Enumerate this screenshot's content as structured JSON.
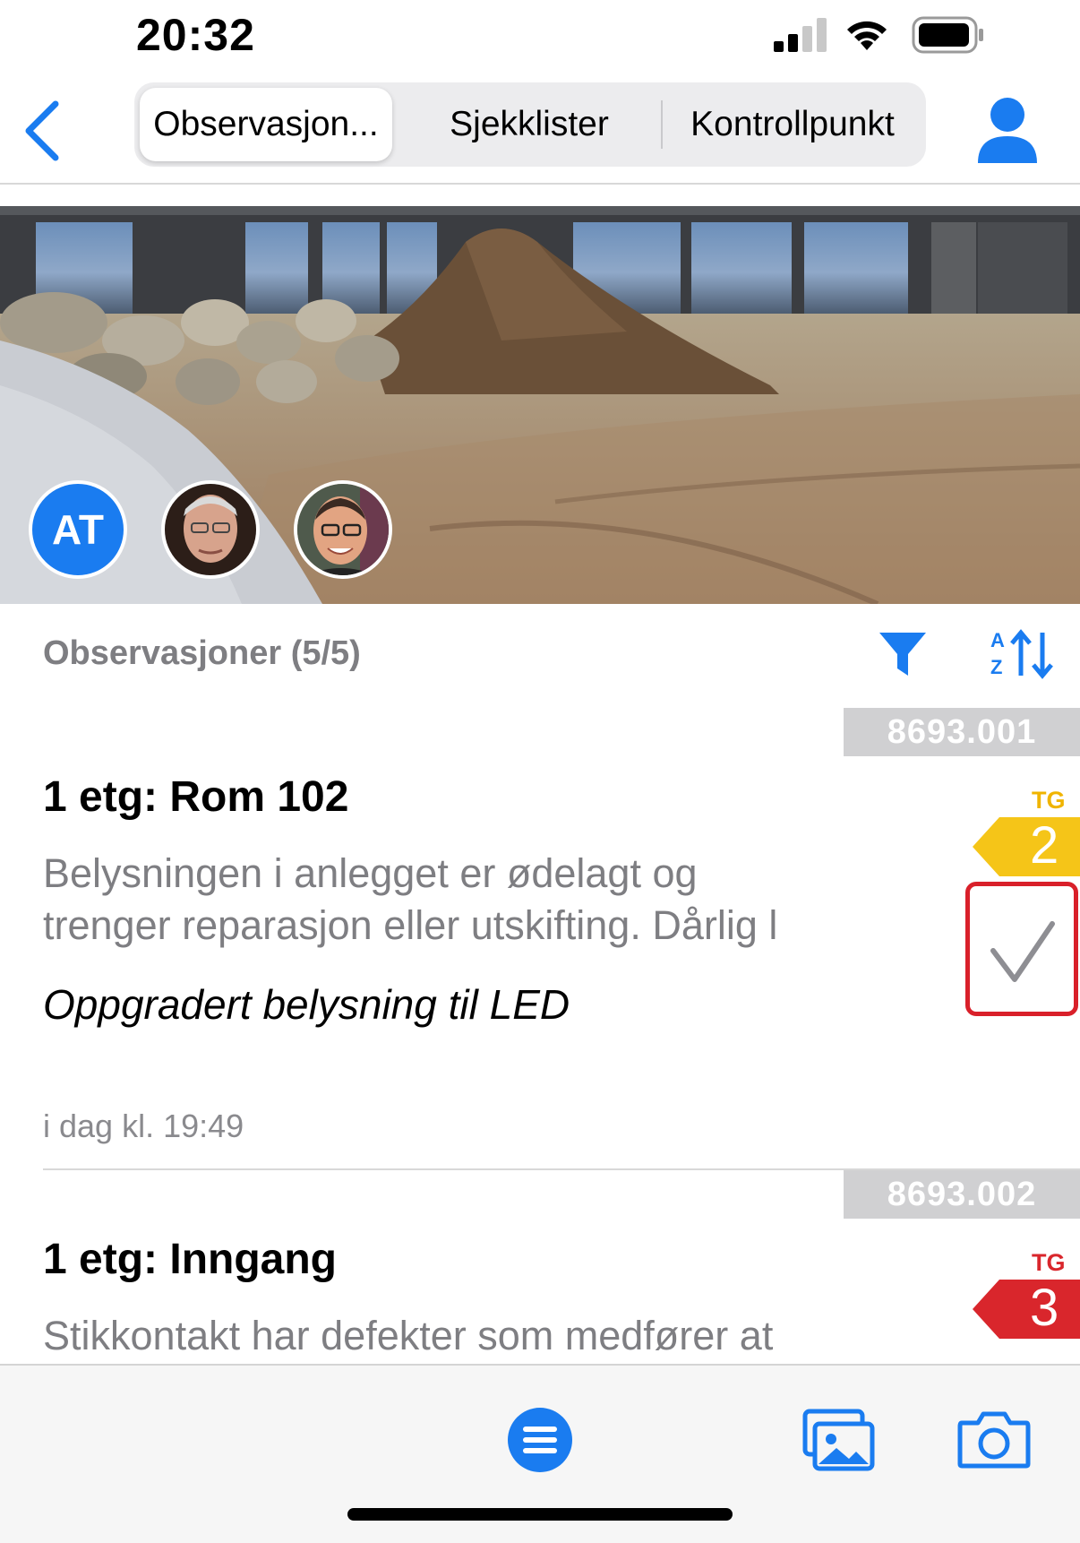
{
  "status_bar": {
    "time": "20:32"
  },
  "nav": {
    "tabs": [
      {
        "label": "Observasjon...",
        "active": true
      },
      {
        "label": "Sjekklister",
        "active": false
      },
      {
        "label": "Kontrollpunkt",
        "active": false
      }
    ]
  },
  "hero": {
    "avatars": [
      {
        "initials": "AT",
        "color": "#1a7cf0"
      },
      {
        "kind": "photo"
      },
      {
        "kind": "photo"
      }
    ]
  },
  "list": {
    "header": "Observasjoner (5/5)",
    "icons": {
      "filter": "filter-icon",
      "sort": "sort-az-icon"
    }
  },
  "observations": [
    {
      "id": "8693.001",
      "title": "1 etg: Rom 102",
      "desc_line1": "Belysningen i anlegget er ødelagt og",
      "desc_line2": "trenger reparasjon eller utskifting. Dårlig l",
      "note": "Oppgradert belysning til LED",
      "time": "i dag kl. 19:49",
      "tg_label": "TG",
      "tg_value": "2",
      "tg_color": "#f5c518",
      "checked": true
    },
    {
      "id": "8693.002",
      "title": "1 etg: Inngang",
      "desc_line1": "Stikkontakt har defekter som medfører at",
      "tg_label": "TG",
      "tg_value": "3",
      "tg_color": "#d9262c"
    }
  ],
  "colors": {
    "accent": "#1a7cf0",
    "check_border": "#d9202a"
  }
}
